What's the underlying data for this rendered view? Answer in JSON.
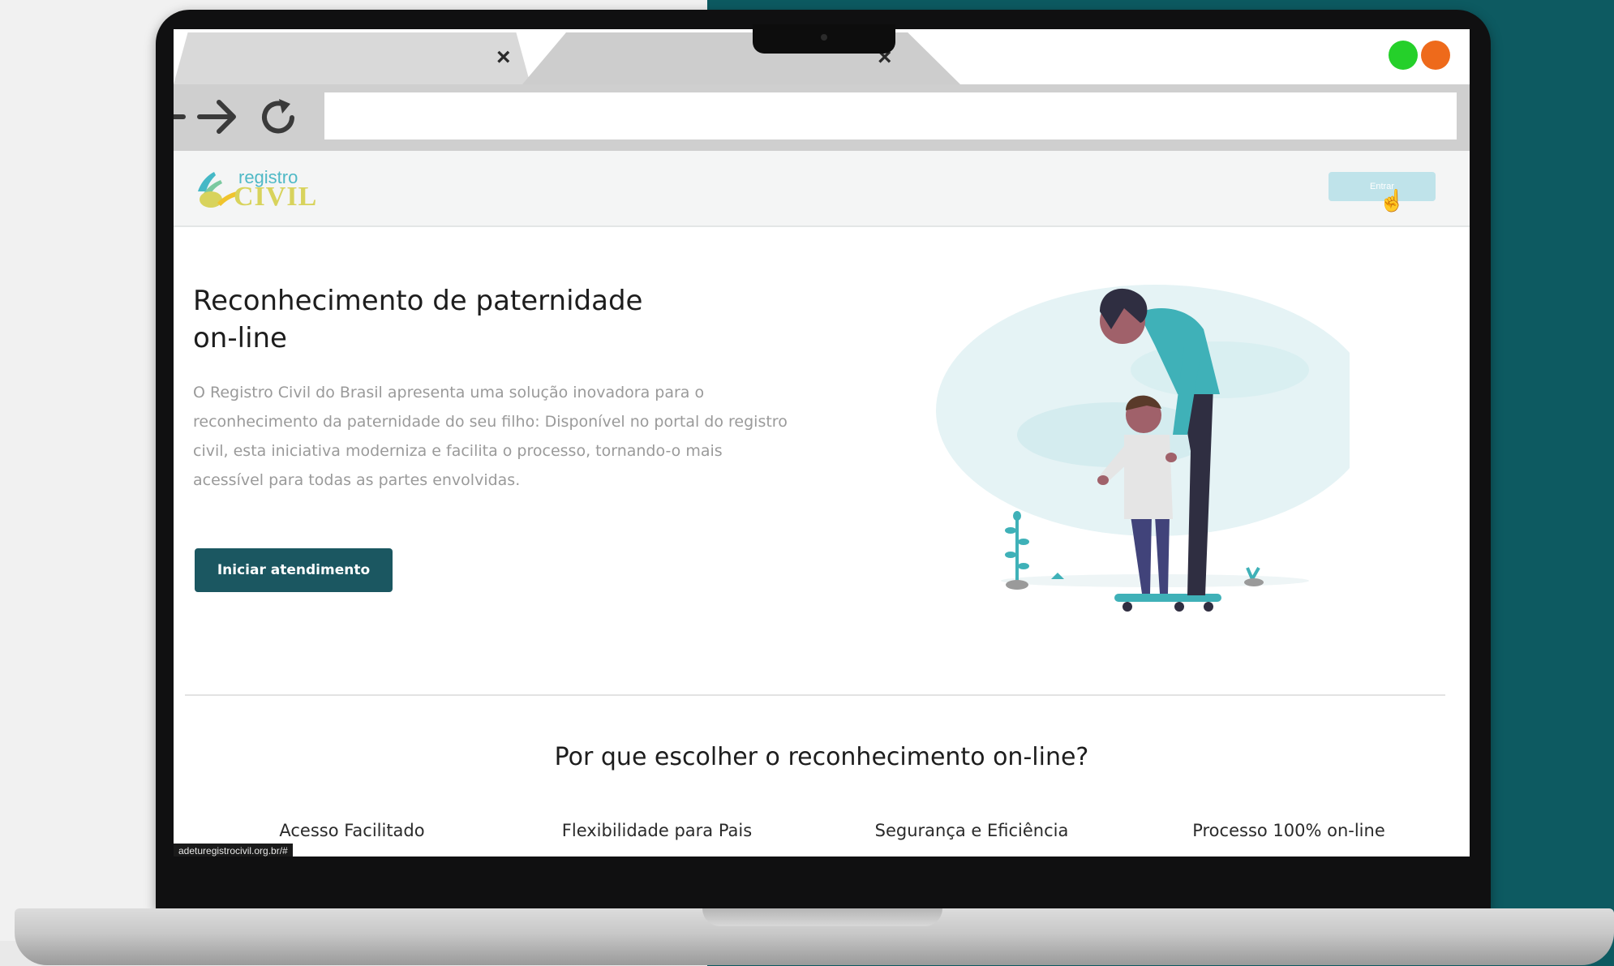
{
  "browser": {
    "tabs": [
      {
        "label": "",
        "close_symbol": "×"
      },
      {
        "label": "",
        "close_symbol": "×"
      }
    ],
    "nav": {
      "back_icon": "back-arrow-icon",
      "forward_icon": "forward-arrow-icon",
      "reload_icon": "reload-icon"
    },
    "address_value": "",
    "window_controls": {
      "green": "#25d02a",
      "orange": "#ee6a1b"
    }
  },
  "site": {
    "logo": {
      "line1": "registro",
      "line2": "CIVIL"
    },
    "header_button_label": "Entrar",
    "hero": {
      "title": "Reconhecimento de paternidade on-line",
      "description": "O Registro Civil do Brasil apresenta uma solução inovadora para o reconhecimento da paternidade do seu filho: Disponível no portal do registro civil, esta iniciativa moderniza e facilita o processo, tornando-o mais acessível para todas as partes envolvidas.",
      "cta_label": "Iniciar atendimento"
    },
    "section_title": "Por que escolher o reconhecimento on-line?",
    "features": [
      "Acesso Facilitado",
      "Flexibilidade para Pais",
      "Segurança e Eficiência",
      "Processo 100% on-line"
    ],
    "status_url": "adeturegistrocivil.org.br/#"
  },
  "colors": {
    "brand_teal": "#1b5761",
    "background_teal": "#0d5a61",
    "illustration_accent": "#3fb1b8"
  }
}
